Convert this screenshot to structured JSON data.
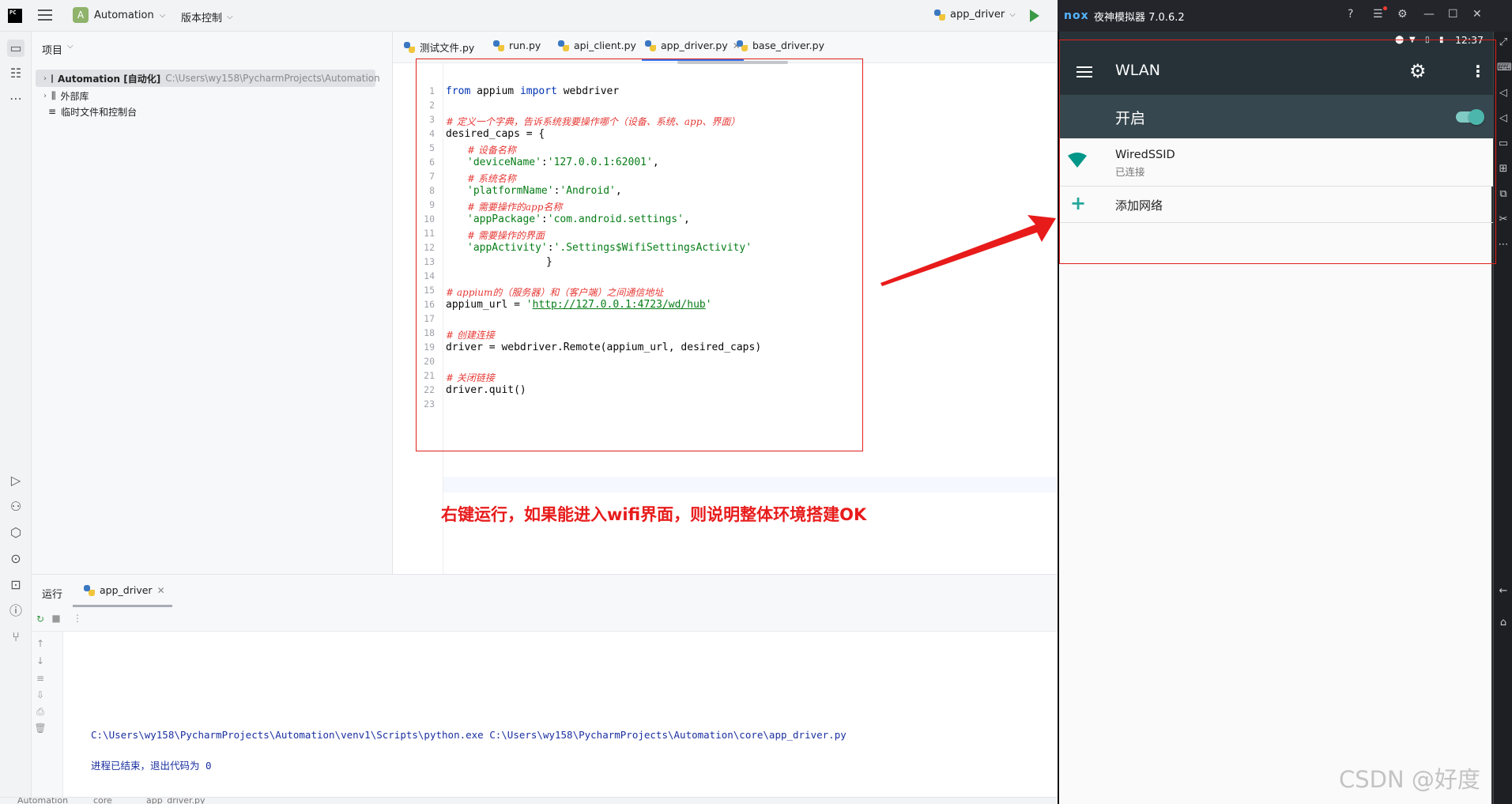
{
  "ide": {
    "logo": "PC",
    "project_name": "Automation",
    "project_avatar": "A",
    "vcs_label": "版本控制",
    "run_config": "app_driver",
    "panel_title": "项目",
    "tree": [
      {
        "name": "Automation [自动化]",
        "path": "C:\\Users\\wy158\\PycharmProjects\\Automation"
      },
      {
        "name": "外部库",
        "path": ""
      },
      {
        "name": "临时文件和控制台",
        "path": ""
      }
    ],
    "tabs": [
      "测试文件.py",
      "run.py",
      "api_client.py",
      "app_driver.py",
      "base_driver.py"
    ],
    "active_tab": "app_driver.py",
    "line_numbers": [
      "1",
      "2",
      "3",
      "4",
      "5",
      "6",
      "7",
      "8",
      "9",
      "10",
      "11",
      "12",
      "13",
      "14",
      "15",
      "16",
      "17",
      "18",
      "19",
      "20",
      "21",
      "22",
      "23"
    ],
    "code": {
      "l1_kw1": "from",
      "l1_mod": " appium ",
      "l1_kw2": "import",
      "l1_rest": " webdriver",
      "l3": "# 定义一个字典，告诉系统我要操作哪个（设备、系统、app、界面）",
      "l4": "desired_caps = {",
      "l5": "# 设备名称",
      "l6_k": "'deviceName'",
      "l6_v": "'127.0.0.1:62001'",
      "l7": "# 系统名称",
      "l8_k": "'platformName'",
      "l8_v": "'Android'",
      "l9": "# 需要操作的app名称",
      "l10_k": "'appPackage'",
      "l10_v": "'com.android.settings'",
      "l11": "# 需要操作的界面",
      "l12_k": "'appActivity'",
      "l12_v": "'.Settings$WifiSettingsActivity'",
      "l13": "}",
      "l15": "# appium的（服务器）和（客户端）之间通信地址",
      "l16_a": "appium_url = ",
      "l16_q1": "'",
      "l16_url": "http://127.0.0.1:4723/wd/hub",
      "l16_q2": "'",
      "l18": "# 创建连接",
      "l19": "driver = webdriver.Remote(appium_url, desired_caps)",
      "l21": "# 关闭链接",
      "l22": "driver.quit()"
    },
    "annotation": "右键运行，如果能进入wifi界面，则说明整体环境搭建OK",
    "run_panel": {
      "title": "运行",
      "tab": "app_driver",
      "console": [
        "C:\\Users\\wy158\\PycharmProjects\\Automation\\venv1\\Scripts\\python.exe C:\\Users\\wy158\\PycharmProjects\\Automation\\core\\app_driver.py",
        "进程已结束，退出代码为 0"
      ]
    },
    "status_crumbs": [
      "Automation",
      "core",
      "app_driver.py"
    ]
  },
  "nox": {
    "logo": "nox",
    "title": "夜神模拟器 7.0.6.2",
    "clock": "12:37",
    "appbar_title": "WLAN",
    "switch_label": "开启",
    "network_name": "WiredSSID",
    "network_status": "已连接",
    "add_network": "添加网络"
  },
  "watermark": "CSDN @好度",
  "colors": {
    "annotation": "#e81b1b",
    "accent": "#26a69a",
    "appbar": "#263238",
    "switchbar": "#37474f"
  }
}
